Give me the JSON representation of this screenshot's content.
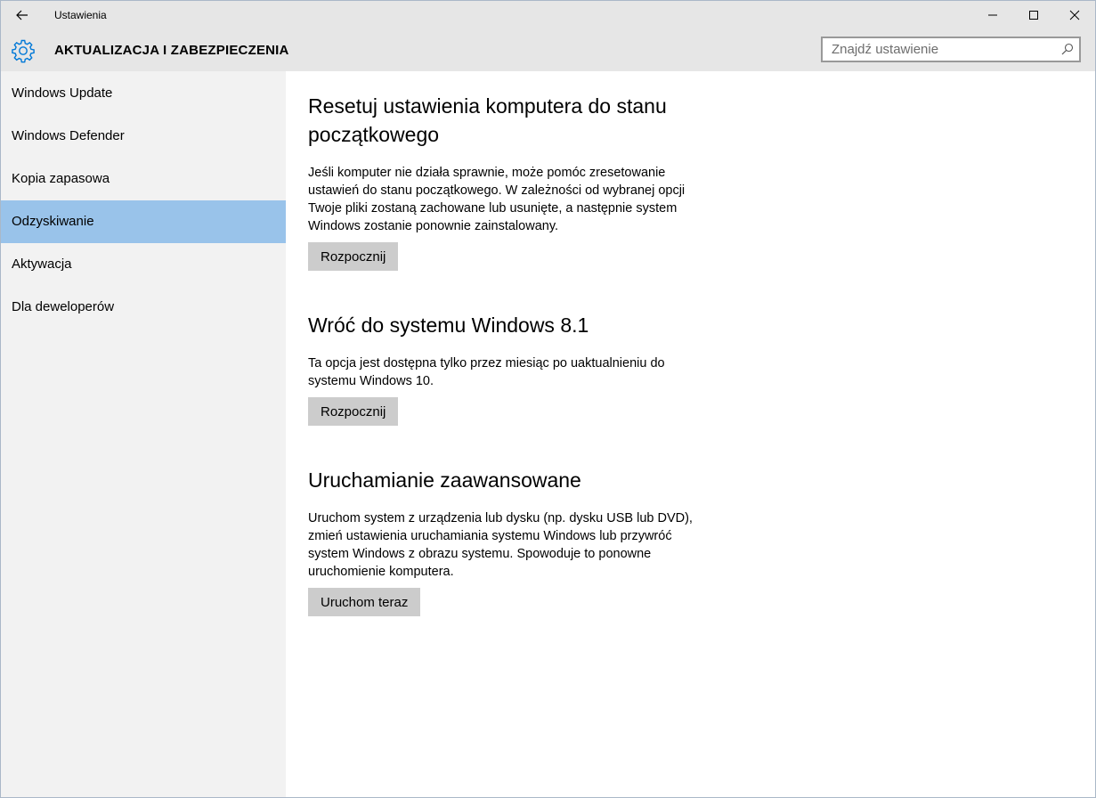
{
  "window": {
    "title": "Ustawienia"
  },
  "header": {
    "section_title": "AKTUALIZACJA I ZABEZPIECZENIA",
    "search_placeholder": "Znajdź ustawienie"
  },
  "sidebar": {
    "items": [
      {
        "label": "Windows Update"
      },
      {
        "label": "Windows Defender"
      },
      {
        "label": "Kopia zapasowa"
      },
      {
        "label": "Odzyskiwanie",
        "active": true
      },
      {
        "label": "Aktywacja"
      },
      {
        "label": "Dla deweloperów"
      }
    ]
  },
  "main": {
    "reset": {
      "title_line1": "Resetuj ustawienia komputera do stanu",
      "title_line2": "początkowego",
      "desc_line1": "Jeśli komputer nie działa sprawnie, może pomóc zresetowanie",
      "desc_line2": "ustawień do stanu początkowego. W zależności od wybranej opcji",
      "desc_line3": "Twoje pliki zostaną zachowane lub usunięte, a następnie system",
      "desc_line4": "Windows zostanie ponownie zainstalowany.",
      "button": "Rozpocznij"
    },
    "rollback": {
      "title": "Wróć do systemu Windows 8.1",
      "desc_line1": "Ta opcja jest dostępna tylko przez miesiąc po uaktualnieniu do",
      "desc_line2": "systemu Windows 10.",
      "button": "Rozpocznij"
    },
    "advanced": {
      "title": "Uruchamianie zaawansowane",
      "desc_line1": "Uruchom system z urządzenia lub dysku (np. dysku USB lub DVD),",
      "desc_line2": "zmień ustawienia uruchamiania systemu Windows lub przywróć",
      "desc_line3": "system Windows z obrazu systemu. Spowoduje to ponowne",
      "desc_line4": "uruchomienie komputera.",
      "button": "Uruchom teraz"
    }
  },
  "colors": {
    "chrome": "#e6e6e6",
    "sidebar": "#f2f2f2",
    "selected": "#99c3ea",
    "accent": "#0078d7",
    "button": "#cccccc"
  },
  "icons": [
    "back-arrow-icon",
    "minimize-icon",
    "maximize-icon",
    "close-icon",
    "gear-icon",
    "search-icon"
  ]
}
